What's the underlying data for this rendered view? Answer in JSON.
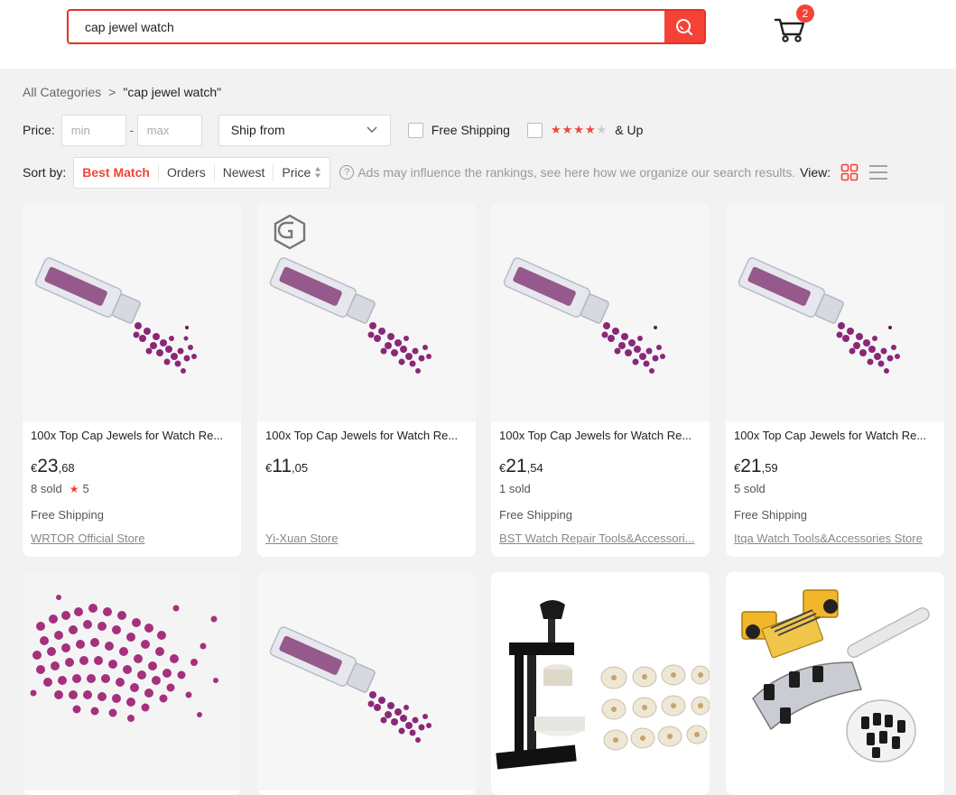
{
  "search": {
    "value": "cap jewel watch"
  },
  "cart": {
    "count": "2"
  },
  "breadcrumb": {
    "root": "All Categories",
    "separator": ">",
    "current": "\"cap jewel watch\""
  },
  "filters": {
    "price_label": "Price:",
    "min_placeholder": "min",
    "dash": "-",
    "max_placeholder": "max",
    "ship_from": "Ship from",
    "free_shipping": "Free Shipping",
    "rating_up": "& Up",
    "rating_stars": 4
  },
  "sort": {
    "label": "Sort by:",
    "options": [
      "Best Match",
      "Orders",
      "Newest",
      "Price"
    ],
    "active": "Best Match",
    "ads_note": "Ads may influence the rankings, see here how we organize our search results.",
    "view_label": "View:"
  },
  "products": [
    {
      "title": "100x Top Cap Jewels for Watch Re...",
      "cur": "€",
      "int": "23",
      "dec": ",68",
      "sold": "8 sold",
      "rating": "5",
      "shipping": "Free Shipping",
      "store": "WRTOR Official Store",
      "image": "jewel-vial"
    },
    {
      "title": "100x Top Cap Jewels for Watch Re...",
      "cur": "€",
      "int": "11",
      "dec": ",05",
      "sold": "",
      "rating": "",
      "shipping": "",
      "store": "Yi-Xuan Store",
      "image": "jewel-vial-logo"
    },
    {
      "title": "100x Top Cap Jewels for Watch Re...",
      "cur": "€",
      "int": "21",
      "dec": ",54",
      "sold": "1 sold",
      "rating": "",
      "shipping": "Free Shipping",
      "store": "BST Watch Repair Tools&Accessori...",
      "image": "jewel-vial"
    },
    {
      "title": "100x Top Cap Jewels for Watch Re...",
      "cur": "€",
      "int": "21",
      "dec": ",59",
      "sold": "5 sold",
      "rating": "",
      "shipping": "Free Shipping",
      "store": "Itqa Watch Tools&Accessories Store",
      "image": "jewel-vial"
    },
    {
      "image": "loose-jewels"
    },
    {
      "image": "jewel-vial"
    },
    {
      "image": "press-tool"
    },
    {
      "image": "case-opener"
    }
  ],
  "colors": {
    "accent": "#f44336",
    "background": "#f2f2f2"
  }
}
